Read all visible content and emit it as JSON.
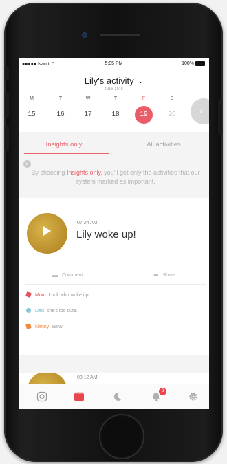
{
  "status_bar": {
    "carrier": "●●●●● Nanit ⌔",
    "time": "5:05 PM",
    "battery": "100%"
  },
  "header": {
    "title": "Lily's activity",
    "subtitle": "JULY 2016"
  },
  "calendar": {
    "days": [
      {
        "letter": "M",
        "number": "15",
        "state": "normal"
      },
      {
        "letter": "T",
        "number": "16",
        "state": "normal"
      },
      {
        "letter": "W",
        "number": "17",
        "state": "normal"
      },
      {
        "letter": "T",
        "number": "18",
        "state": "normal"
      },
      {
        "letter": "F",
        "number": "19",
        "state": "active"
      },
      {
        "letter": "S",
        "number": "20",
        "state": "faded"
      }
    ]
  },
  "tabs": {
    "insights": "Insights only",
    "all": "All activities"
  },
  "info": {
    "prefix": "By choosing ",
    "highlight": "Insights only",
    "suffix": ", you'll get only the activities that our system marked as important."
  },
  "event": {
    "time": "07:24 AM",
    "title": "Lily woke up!",
    "actions": {
      "comment": "Comment",
      "share": "Share"
    },
    "comments": [
      {
        "author": "Mom",
        "text": "Look who woke up.",
        "kind": "mom"
      },
      {
        "author": "Dad",
        "text": "she's too cute.",
        "kind": "dad"
      },
      {
        "author": "Nanny",
        "text": "Wow!",
        "kind": "nanny"
      }
    ]
  },
  "event2": {
    "time": "03:12 AM"
  },
  "tabbar": {
    "notifications_badge": "3"
  },
  "colors": {
    "accent": "#ea5c67",
    "gold": "#c9a23c",
    "muted": "#b3b3b3"
  }
}
